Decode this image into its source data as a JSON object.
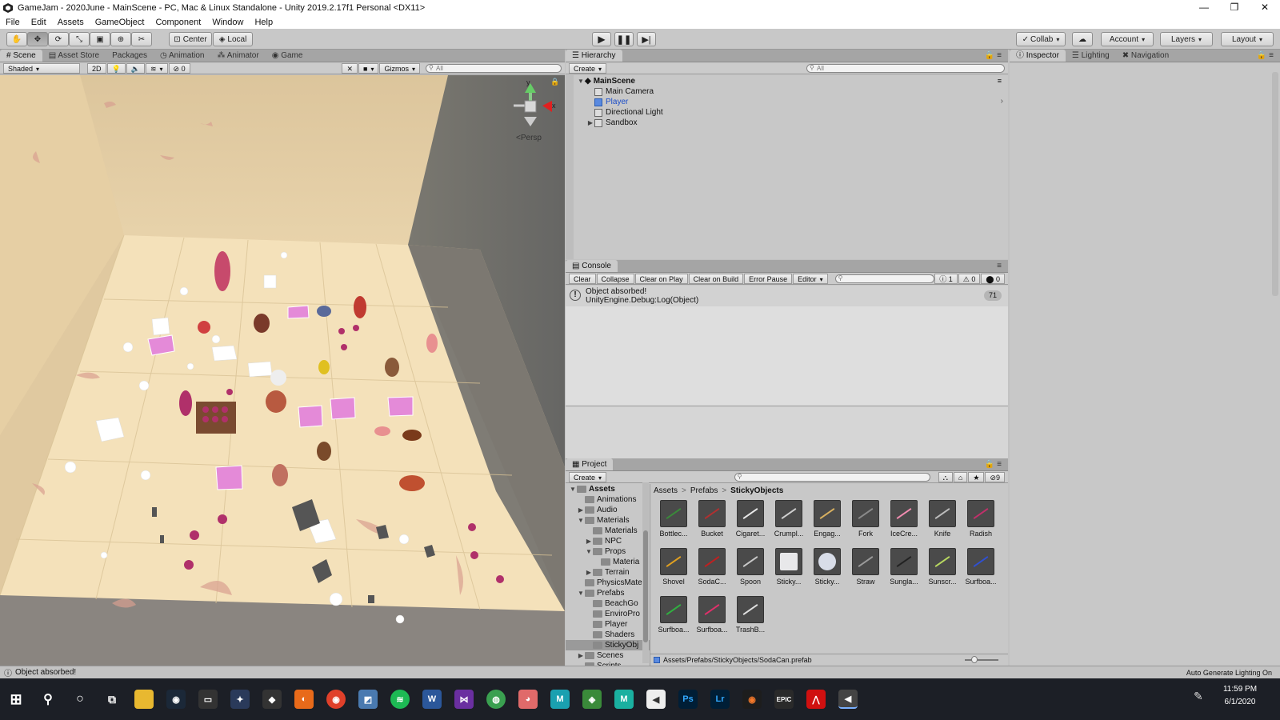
{
  "window": {
    "title": "GameJam - 2020June - MainScene - PC, Mac & Linux Standalone - Unity 2019.2.17f1 Personal <DX11>",
    "minimize": "—",
    "restore": "❐",
    "close": "✕"
  },
  "menu": [
    "File",
    "Edit",
    "Assets",
    "GameObject",
    "Component",
    "Window",
    "Help"
  ],
  "toolbar": {
    "pivot": "Center",
    "space": "Local",
    "collab": "Collab",
    "account": "Account",
    "layers": "Layers",
    "layout": "Layout"
  },
  "scene": {
    "tabs": [
      "Scene",
      "Asset Store",
      "Packages",
      "Animation",
      "Animator",
      "Game"
    ],
    "shading": "Shaded",
    "mode2d": "2D",
    "hidden_count": "0",
    "gizmos": "Gizmos",
    "search_placeholder": "All",
    "gizmo_y": "y",
    "gizmo_x": "x",
    "persp": "Persp"
  },
  "hierarchy": {
    "tab": "Hierarchy",
    "create": "Create",
    "search_placeholder": "All",
    "scene_name": "MainScene",
    "items": [
      "Main Camera",
      "Player",
      "Directional Light",
      "Sandbox"
    ]
  },
  "console": {
    "tab": "Console",
    "buttons": [
      "Clear",
      "Collapse",
      "Clear on Play",
      "Clear on Build",
      "Error Pause",
      "Editor"
    ],
    "info_count": "1",
    "warn_count": "0",
    "error_count": "0",
    "message_line1": "Object absorbed!",
    "message_line2": "UnityEngine.Debug:Log(Object)",
    "message_count": "71"
  },
  "project": {
    "tab": "Project",
    "create": "Create",
    "hidden_count": "9",
    "tree": [
      {
        "label": "Assets",
        "depth": 0,
        "arrow": "▼"
      },
      {
        "label": "Animations",
        "depth": 1,
        "arrow": ""
      },
      {
        "label": "Audio",
        "depth": 1,
        "arrow": "▶"
      },
      {
        "label": "Materials",
        "depth": 1,
        "arrow": "▼"
      },
      {
        "label": "Materials",
        "depth": 2,
        "arrow": ""
      },
      {
        "label": "NPC",
        "depth": 2,
        "arrow": "▶"
      },
      {
        "label": "Props",
        "depth": 2,
        "arrow": "▼"
      },
      {
        "label": "Materia",
        "depth": 3,
        "arrow": ""
      },
      {
        "label": "Terrain",
        "depth": 2,
        "arrow": "▶"
      },
      {
        "label": "PhysicsMate",
        "depth": 1,
        "arrow": ""
      },
      {
        "label": "Prefabs",
        "depth": 1,
        "arrow": "▼"
      },
      {
        "label": "BeachGo",
        "depth": 2,
        "arrow": ""
      },
      {
        "label": "EnviroPro",
        "depth": 2,
        "arrow": ""
      },
      {
        "label": "Player",
        "depth": 2,
        "arrow": ""
      },
      {
        "label": "Shaders",
        "depth": 2,
        "arrow": ""
      },
      {
        "label": "StickyObj",
        "depth": 2,
        "arrow": ""
      },
      {
        "label": "Scenes",
        "depth": 1,
        "arrow": "▶"
      },
      {
        "label": "Scripts",
        "depth": 1,
        "arrow": ""
      }
    ],
    "breadcrumb": [
      "Assets",
      "Prefabs",
      "StickyObjects"
    ],
    "breadcrumb_sep": ">",
    "assets": [
      {
        "label": "Bottlec...",
        "color": "#3a8a3a"
      },
      {
        "label": "Bucket",
        "color": "#b03030"
      },
      {
        "label": "Cigaret...",
        "color": "#e8e8e8"
      },
      {
        "label": "Crumpl...",
        "color": "#cfcfcf"
      },
      {
        "label": "Engag...",
        "color": "#d8b060"
      },
      {
        "label": "Fork",
        "color": "#8a8a8a"
      },
      {
        "label": "IceCre...",
        "color": "#f08cb0"
      },
      {
        "label": "Knife",
        "color": "#bcbcbc"
      },
      {
        "label": "Radish",
        "color": "#c0306a"
      },
      {
        "label": "Shovel",
        "color": "#e0a020"
      },
      {
        "label": "SodaC...",
        "color": "#c02020"
      },
      {
        "label": "Spoon",
        "color": "#c8c8c8"
      },
      {
        "label": "Sticky...",
        "color": "#e8e8ea"
      },
      {
        "label": "Sticky...",
        "color": "#d8dde8"
      },
      {
        "label": "Straw",
        "color": "#9a9a9a"
      },
      {
        "label": "Sungla...",
        "color": "#222222"
      },
      {
        "label": "Sunscr...",
        "color": "#b8d860"
      },
      {
        "label": "Surfboa...",
        "color": "#3050d0"
      },
      {
        "label": "Surfboa...",
        "color": "#30b040"
      },
      {
        "label": "Surfboa...",
        "color": "#e0306a"
      },
      {
        "label": "TrashB...",
        "color": "#e0e0e0"
      }
    ],
    "selected_path": "Assets/Prefabs/StickyObjects/SodaCan.prefab"
  },
  "inspector": {
    "tabs": [
      "Inspector",
      "Lighting",
      "Navigation"
    ]
  },
  "status": {
    "message": "Object absorbed!",
    "right": "Auto Generate Lighting On"
  },
  "taskbar": {
    "time": "11:59 PM",
    "date": "6/1/2020",
    "apps": [
      "W",
      "Ps",
      "Lr",
      "M",
      "EPIC"
    ]
  }
}
